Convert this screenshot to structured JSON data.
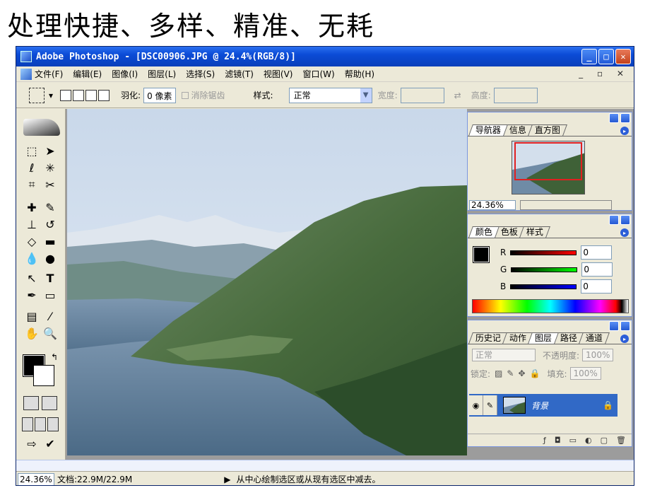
{
  "slide": {
    "title": "处理快捷、多样、精准、无耗"
  },
  "window": {
    "title": "Adobe Photoshop - [DSC00906.JPG @ 24.4%(RGB/8)]"
  },
  "menu": [
    "文件(F)",
    "编辑(E)",
    "图像(I)",
    "图层(L)",
    "选择(S)",
    "滤镜(T)",
    "视图(V)",
    "窗口(W)",
    "帮助(H)"
  ],
  "options": {
    "feather_label": "羽化:",
    "feather_value": "0 像素",
    "antialias_label": "消除锯齿",
    "style_label": "样式:",
    "style_value": "正常",
    "width_label": "宽度:",
    "height_label": "高度:"
  },
  "navigator": {
    "tabs": [
      "导航器",
      "信息",
      "直方图"
    ],
    "zoom": "24.36%"
  },
  "color": {
    "tabs": [
      "颜色",
      "色板",
      "样式"
    ],
    "channels": [
      {
        "label": "R",
        "value": "0",
        "color": "#ff0000"
      },
      {
        "label": "G",
        "value": "0",
        "color": "#00c000"
      },
      {
        "label": "B",
        "value": "0",
        "color": "#0000ff"
      }
    ]
  },
  "layers": {
    "tabs": [
      "历史记",
      "动作",
      "图层",
      "路径",
      "通道"
    ],
    "blend_mode": "正常",
    "opacity_label": "不透明度:",
    "opacity_value": "100%",
    "lock_label": "锁定:",
    "fill_label": "填充:",
    "fill_value": "100%",
    "layer_name": "背景"
  },
  "status": {
    "zoom": "24.36%",
    "doc": "文档:22.9M/22.9M",
    "hint": "从中心绘制选区或从现有选区中减去。"
  },
  "colors": {
    "title_bar": "#0b4bd6",
    "selected_layer": "#3169c6"
  }
}
